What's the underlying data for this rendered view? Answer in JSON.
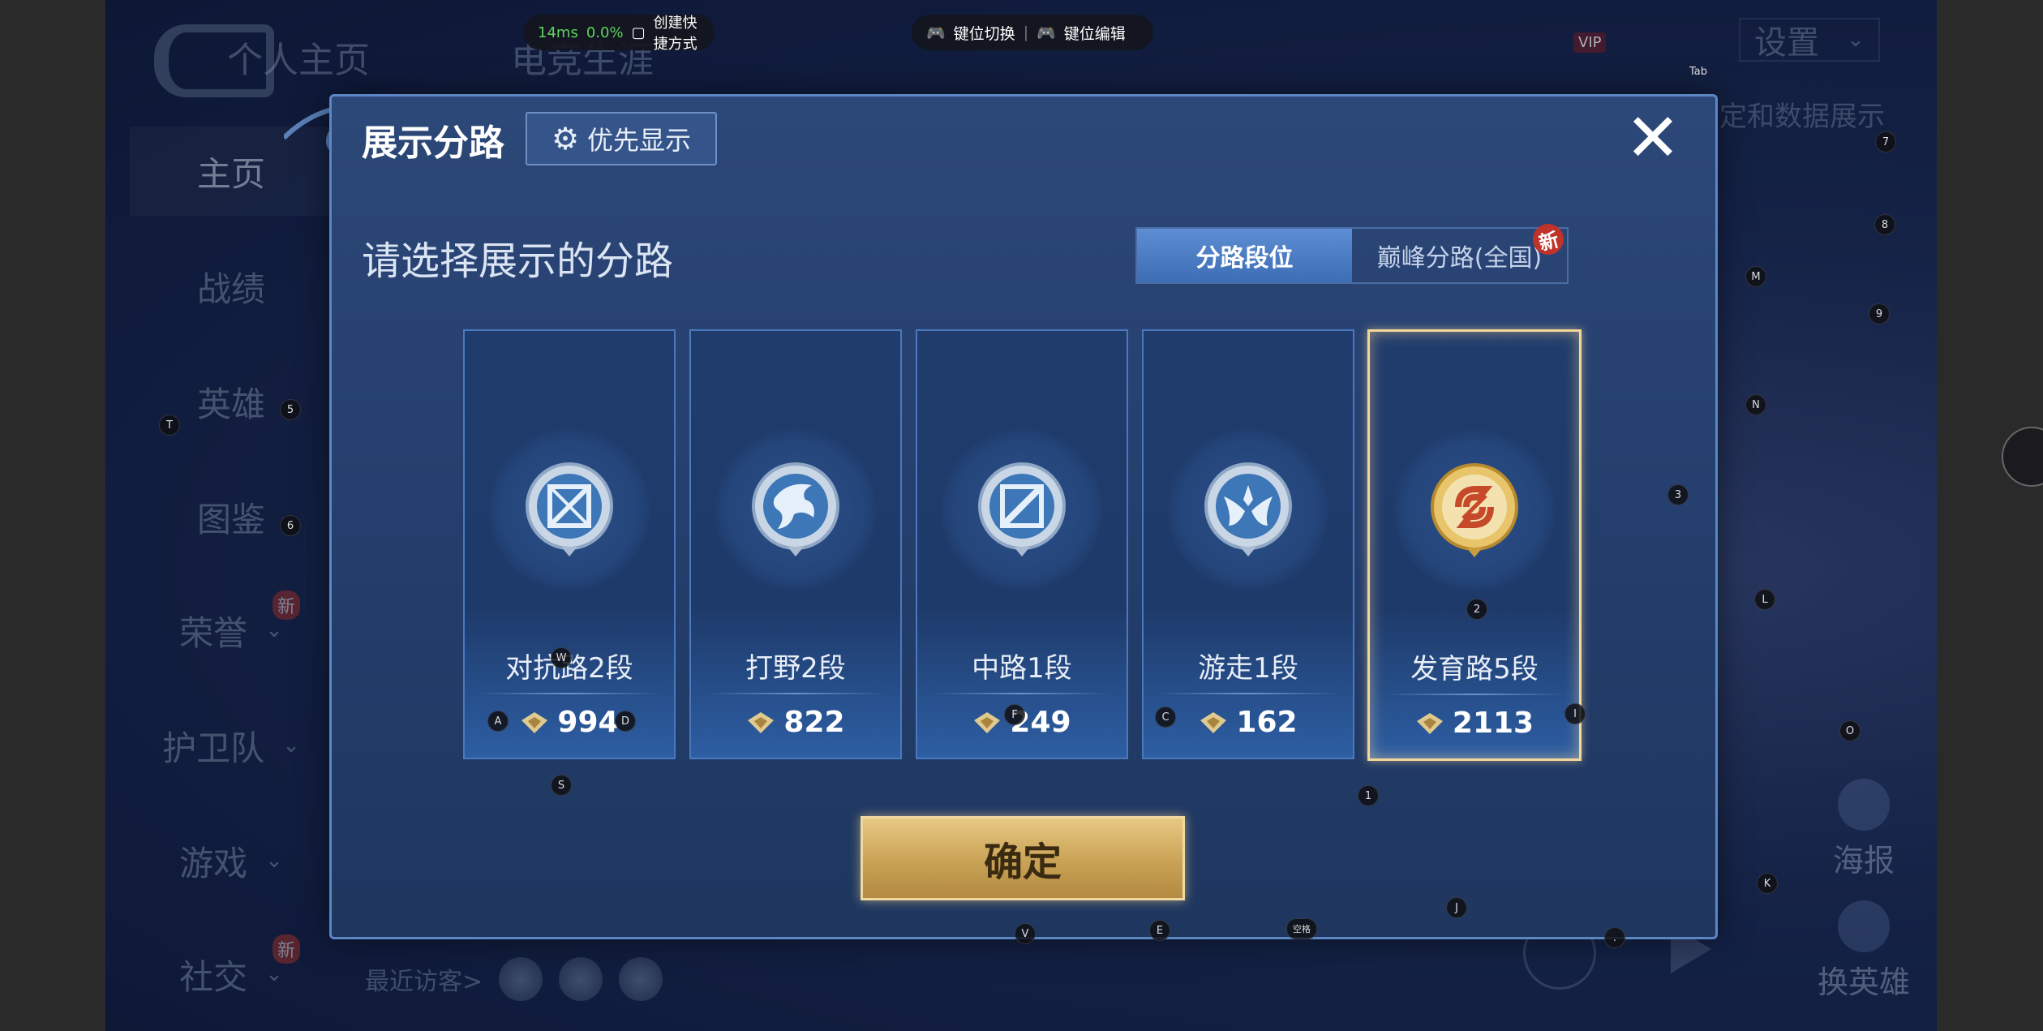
{
  "hud": {
    "latency": "14ms",
    "loss": "0.0%",
    "shortcut": "创建快捷方式",
    "key_switch": "键位切换",
    "key_edit": "键位编辑"
  },
  "background": {
    "tabs": [
      "个人主页",
      "电竞生涯"
    ],
    "settings": "设置",
    "data_display": "定和数据展示",
    "nav": [
      {
        "label": "主页",
        "chevron": false,
        "new": false
      },
      {
        "label": "战绩",
        "chevron": false,
        "new": false
      },
      {
        "label": "英雄",
        "chevron": false,
        "new": false
      },
      {
        "label": "图鉴",
        "chevron": false,
        "new": false
      },
      {
        "label": "荣誉",
        "chevron": true,
        "new": true
      },
      {
        "label": "护卫队",
        "chevron": true,
        "new": false
      },
      {
        "label": "游戏",
        "chevron": true,
        "new": false
      },
      {
        "label": "社交",
        "chevron": true,
        "new": true
      }
    ],
    "new_badge": "新",
    "recent_visitors": "最近访客>",
    "poster": "海报",
    "change_hero": "换英雄",
    "vip": "VIP"
  },
  "modal": {
    "title": "展示分路",
    "priority_button": "优先显示",
    "subtitle": "请选择展示的分路",
    "tabs": [
      {
        "label": "分路段位",
        "active": true
      },
      {
        "label": "巅峰分路(全国)",
        "active": false,
        "badge": "新"
      }
    ],
    "lanes": [
      {
        "name": "对抗路2段",
        "score": "994",
        "selected": false
      },
      {
        "name": "打野2段",
        "score": "822",
        "selected": false
      },
      {
        "name": "中路1段",
        "score": "249",
        "selected": false
      },
      {
        "name": "游走1段",
        "score": "162",
        "selected": false
      },
      {
        "name": "发育路5段",
        "score": "2113",
        "selected": true
      }
    ],
    "confirm": "确定",
    "close": "✕"
  },
  "key_labels": [
    "Tab",
    "7",
    "8",
    "M",
    "9",
    "N",
    "3",
    "L",
    "O",
    "K",
    "J",
    "2",
    "1",
    "S",
    "A",
    "D",
    "W",
    "F",
    "C",
    "V",
    "E",
    "空格",
    ".",
    "5",
    "6",
    "T",
    "I"
  ]
}
